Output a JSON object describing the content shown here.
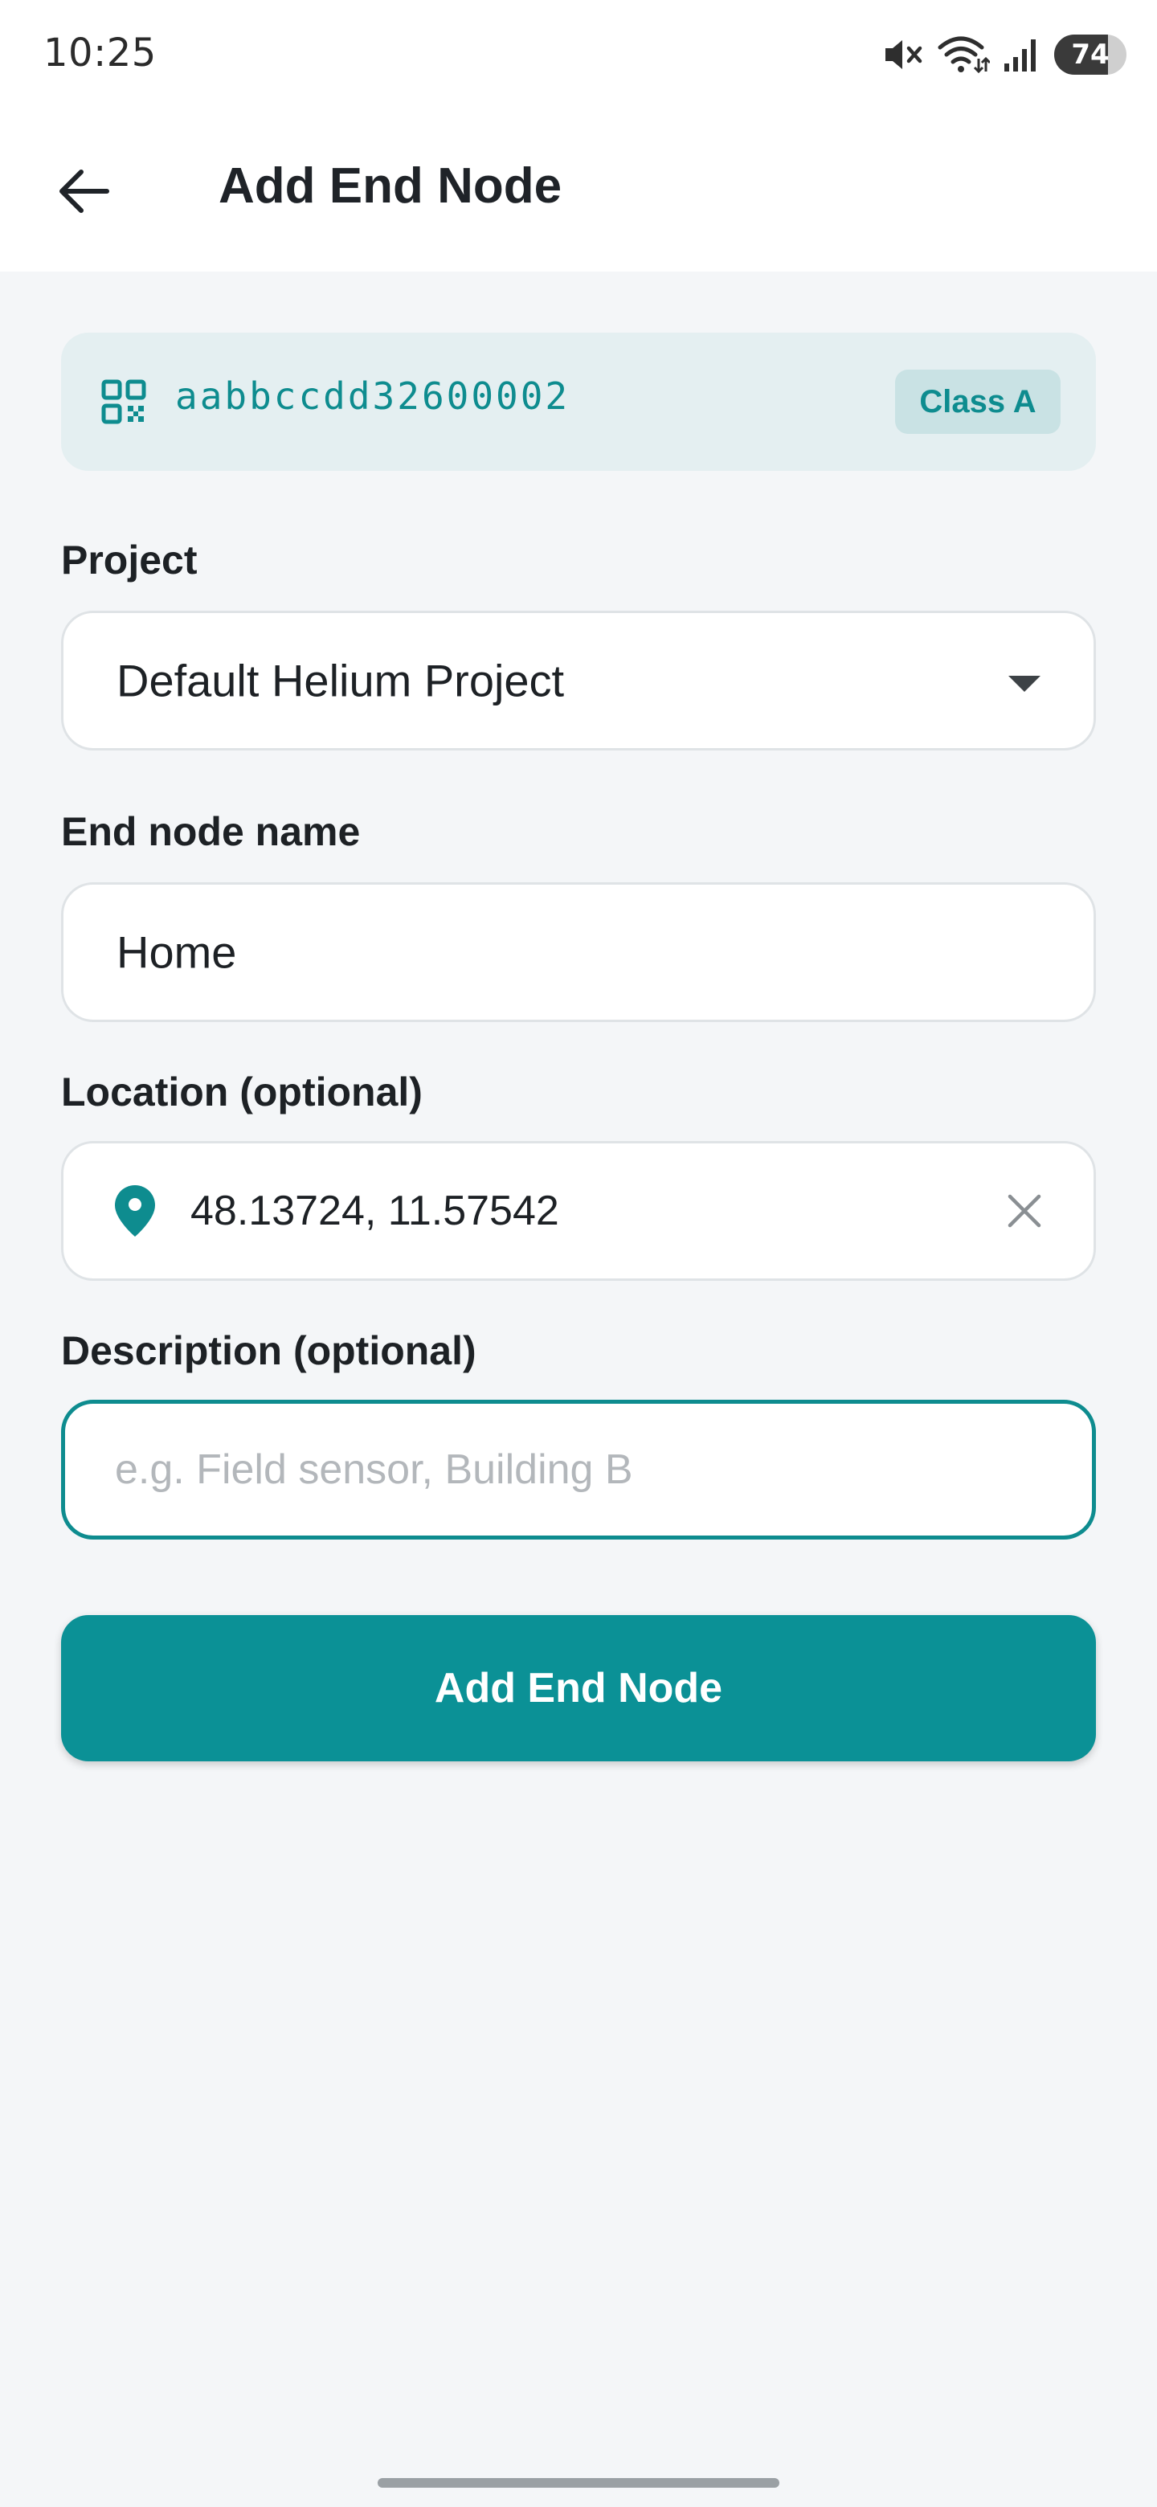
{
  "status_bar": {
    "time": "10:25",
    "battery_level": "74",
    "battery_fraction": 0.74,
    "icons": [
      "mute-icon",
      "wifi-icon",
      "signal-icon",
      "battery-icon"
    ]
  },
  "app_bar": {
    "title": "Add End Node",
    "back_icon": "arrow-left-icon"
  },
  "device": {
    "eui": "aabbccdd32600002",
    "class_label": "Class A",
    "icon": "qr-code-icon"
  },
  "form": {
    "project": {
      "label": "Project",
      "value": "Default Helium Project"
    },
    "name": {
      "label": "End node name",
      "value": "Home"
    },
    "location": {
      "label": "Location (optional)",
      "value": "48.13724, 11.57542",
      "icon": "map-pin-icon",
      "clear_icon": "close-icon"
    },
    "description": {
      "label": "Description (optional)",
      "value": "",
      "placeholder": "e.g. Field sensor, Building B"
    },
    "submit_label": "Add End Node"
  },
  "colors": {
    "accent": "#0b9196",
    "accent_text": "#0e8c8f",
    "card_bg": "#e4eff1",
    "page_bg": "#f4f6f8"
  }
}
